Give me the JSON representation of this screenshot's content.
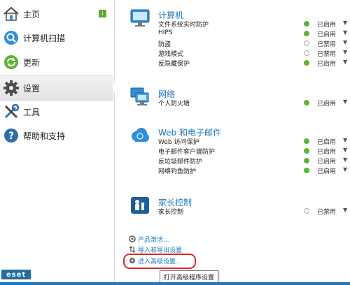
{
  "sidebar": {
    "items": [
      {
        "label": "主页",
        "badge": "i"
      },
      {
        "label": "计算机扫描"
      },
      {
        "label": "更新"
      },
      {
        "label": "设置"
      },
      {
        "label": "工具"
      },
      {
        "label": "帮助和支持"
      }
    ],
    "active": "设置",
    "logo": "eset"
  },
  "sections": [
    {
      "title": "计算机",
      "rows": [
        {
          "label": "文件系统实时防护",
          "status": "已启用",
          "on": true
        },
        {
          "label": "HIPS",
          "status": "已启用",
          "on": true
        },
        {
          "label": "防盗",
          "status": "已禁用",
          "on": false
        },
        {
          "label": "游戏模式",
          "status": "已禁用",
          "on": false
        },
        {
          "label": "反隐藏保护",
          "status": "已启用",
          "on": true
        }
      ]
    },
    {
      "title": "网络",
      "rows": [
        {
          "label": "个人防火墙",
          "status": "已启用",
          "on": true
        }
      ]
    },
    {
      "title": "Web 和电子邮件",
      "rows": [
        {
          "label": "Web 访问保护",
          "status": "已启用",
          "on": true
        },
        {
          "label": "电子邮件客户端防护",
          "status": "已启用",
          "on": true
        },
        {
          "label": "反垃圾邮件防护",
          "status": "已启用",
          "on": true
        },
        {
          "label": "网络钓鱼防护",
          "status": "已启用",
          "on": true
        }
      ]
    },
    {
      "title": "家长控制",
      "rows": [
        {
          "label": "家长控制",
          "status": "已禁用",
          "on": false
        }
      ]
    }
  ],
  "links": [
    {
      "label": "产品激活..."
    },
    {
      "label": "导入和导出设置"
    },
    {
      "label": "进入高级设置..."
    }
  ],
  "tooltip": "打开高级程序设置",
  "colors": {
    "accent": "#1e79c2",
    "enabled": "#5db336",
    "highlight": "#d42a2a"
  }
}
